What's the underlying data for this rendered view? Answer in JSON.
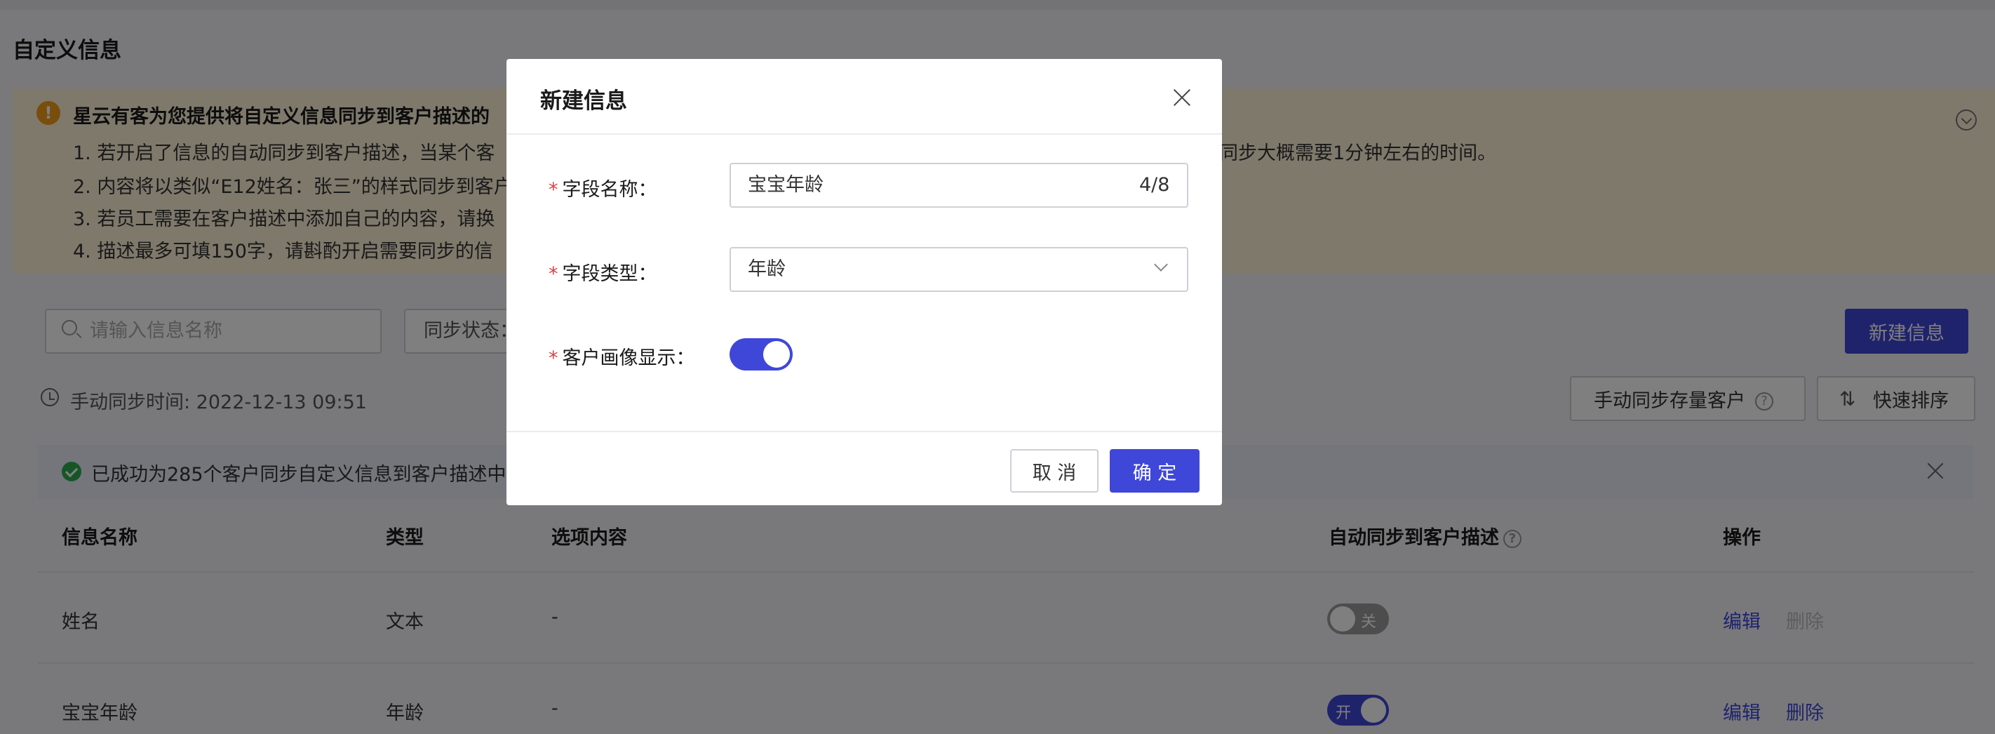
{
  "page": {
    "title": "自定义信息"
  },
  "notice": {
    "title": "星云有客为您提供将自定义信息同步到客户描述的",
    "lines": [
      "1. 若开启了信息的自动同步到客户描述，当某个客                                                                                                                                         同步大概需要1分钟左右的时间。",
      "2. 内容将以类似“E12姓名：张三”的样式同步到客户",
      "3. 若员工需要在客户描述中添加自己的内容，请换",
      "4. 描述最多可填150字，请斟酌开启需要同步的信"
    ],
    "line1_left": "1. 若开启了信息的自动同步到客户描述，当某个客",
    "line1_right": "同步大概需要1分钟左右的时间。"
  },
  "toolbar": {
    "search_placeholder": "请输入信息名称",
    "sync_status_label": "同步状态：",
    "new_info_label": "新建信息"
  },
  "sync": {
    "time_text": "手动同步时间: 2022-12-13 09:51",
    "manual_sync_label": "手动同步存量客户",
    "quick_sort_label": "快速排序"
  },
  "success": {
    "text": "已成功为285个客户同步自定义信息到客户描述中"
  },
  "table": {
    "headers": {
      "name": "信息名称",
      "type": "类型",
      "options": "选项内容",
      "auto_sync": "自动同步到客户描述",
      "actions": "操作"
    },
    "rows": [
      {
        "name": "姓名",
        "type": "文本",
        "options": "-",
        "toggle_label": "关",
        "edit": "编辑",
        "delete": "删除"
      },
      {
        "name": "宝宝年龄",
        "type": "年龄",
        "options": "-",
        "toggle_label": "开",
        "edit": "编辑",
        "delete": "删除"
      }
    ]
  },
  "modal": {
    "title": "新建信息",
    "field_name_label": "字段名称：",
    "field_name_value": "宝宝年龄",
    "field_name_count": "4/8",
    "field_type_label": "字段类型：",
    "field_type_value": "年龄",
    "portrait_label": "客户画像显示：",
    "required_mark": "*",
    "cancel_label": "取 消",
    "confirm_label": "确 定"
  },
  "colors": {
    "primary": "#3f47d9",
    "warning": "#f29b17",
    "success": "#2eaa4f",
    "required": "#e83b3b"
  }
}
